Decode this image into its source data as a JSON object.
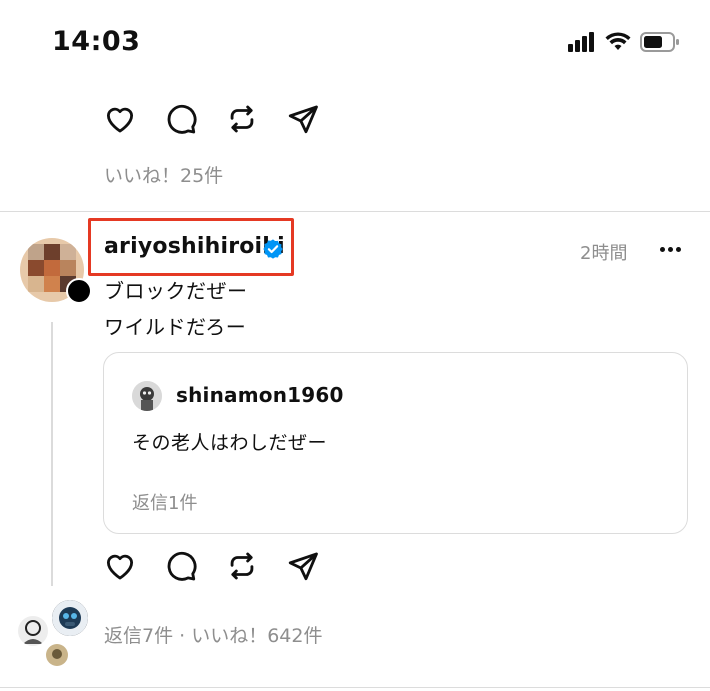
{
  "status_bar": {
    "time": "14:03",
    "icons": [
      "cellular-signal-icon",
      "wifi-icon",
      "battery-icon"
    ]
  },
  "previous_post": {
    "actions": [
      "heart-icon",
      "comment-icon",
      "repost-icon",
      "share-icon"
    ],
    "likes": "いいね！25件"
  },
  "post": {
    "username": "ariyoshihiroiki",
    "verified": true,
    "time": "2時間",
    "lines": [
      "ブロックだぜー",
      "ワイルドだろー"
    ],
    "quote": {
      "username": "shinamon1960",
      "text": "その老人はわしだぜー",
      "replies": "返信1件"
    },
    "actions": [
      "heart-icon",
      "comment-icon",
      "repost-icon",
      "share-icon"
    ],
    "footer": "返信7件 · いいね！642件"
  },
  "colors": {
    "highlight": "#e53923",
    "verified": "#0095f6",
    "muted": "#8e8e8e"
  }
}
